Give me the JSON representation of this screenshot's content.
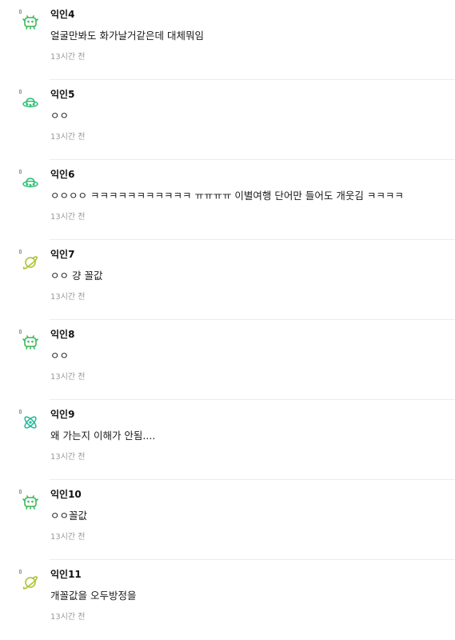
{
  "comments": [
    {
      "nickname": "익인4",
      "text": "얼굴만봐도 화가날거같은데 대체뭐임",
      "time": "13시간 전",
      "avatar_icon": "green-critter-icon"
    },
    {
      "nickname": "익인5",
      "text": "ㅇㅇ",
      "time": "13시간 전",
      "avatar_icon": "ufo-icon"
    },
    {
      "nickname": "익인6",
      "text": "ㅇㅇㅇㅇ ㅋㅋㅋㅋㅋㅋㅋㅋㅋㅋㅋ ㅠㅠㅠㅠ 이별여행 단어만 들어도 개웃김 ㅋㅋㅋㅋ",
      "time": "13시간 전",
      "avatar_icon": "ufo-icon"
    },
    {
      "nickname": "익인7",
      "text": "ㅇㅇ 걍 꼴값",
      "time": "13시간 전",
      "avatar_icon": "planet-icon"
    },
    {
      "nickname": "익인8",
      "text": "ㅇㅇ",
      "time": "13시간 전",
      "avatar_icon": "green-critter-icon"
    },
    {
      "nickname": "익인9",
      "text": "왜 가는지 이해가 안됨....",
      "time": "13시간 전",
      "avatar_icon": "atom-icon"
    },
    {
      "nickname": "익인10",
      "text": "ㅇㅇ꼴값",
      "time": "13시간 전",
      "avatar_icon": "green-critter-icon"
    },
    {
      "nickname": "익인11",
      "text": "개꼴값을 오두방정을",
      "time": "13시간 전",
      "avatar_icon": "planet-icon"
    }
  ],
  "colors": {
    "critter": "#3dbb5a",
    "ufo": "#2fbf73",
    "planet": "#a7c22b",
    "atom": "#22b89a"
  }
}
